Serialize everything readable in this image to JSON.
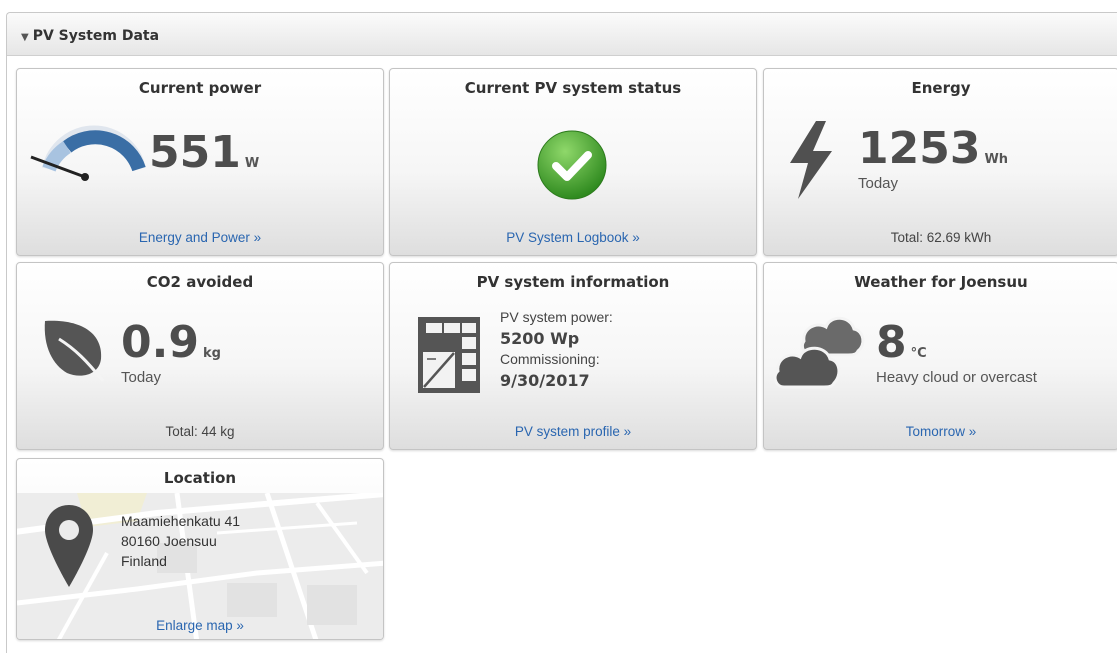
{
  "panel": {
    "title": "PV System Data"
  },
  "tiles": {
    "current_power": {
      "title": "Current power",
      "value": "551",
      "unit": "W",
      "link": "Energy and Power »"
    },
    "status": {
      "title": "Current PV system status",
      "link": "PV System Logbook »"
    },
    "energy": {
      "title": "Energy",
      "value": "1253",
      "unit": "Wh",
      "period": "Today",
      "total": "Total: 62.69 kWh"
    },
    "co2": {
      "title": "CO2 avoided",
      "value": "0.9",
      "unit": "kg",
      "period": "Today",
      "total": "Total: 44 kg"
    },
    "info": {
      "title": "PV system information",
      "power_label": "PV system power:",
      "power_value": "5200 Wp",
      "commissioning_label": "Commissioning:",
      "commissioning_value": "9/30/2017",
      "link": "PV system profile »"
    },
    "weather": {
      "title": "Weather for Joensuu",
      "value": "8",
      "unit": "°C",
      "description": "Heavy cloud or overcast",
      "link": "Tomorrow »"
    },
    "location": {
      "title": "Location",
      "street": "Maamiehenkatu 41",
      "city": "80160 Joensuu",
      "country": "Finland",
      "link": "Enlarge map »"
    }
  },
  "icons": {
    "gauge": "gauge-icon",
    "check": "check-circle-icon",
    "bolt": "lightning-icon",
    "leaf": "leaf-icon",
    "solar": "solar-panel-icon",
    "cloud": "cloud-icon",
    "pin": "map-pin-icon"
  },
  "colors": {
    "link": "#2a66b0",
    "status_ok": "#3aa12a",
    "gauge_blue": "#3a6ea5"
  }
}
